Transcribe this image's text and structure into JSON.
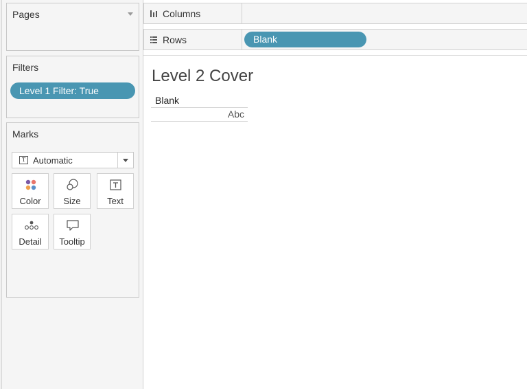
{
  "pages": {
    "title": "Pages"
  },
  "filters": {
    "title": "Filters",
    "items": [
      {
        "label": "Level 1 Filter: True"
      }
    ]
  },
  "marks": {
    "title": "Marks",
    "mark_type": "Automatic",
    "buttons": [
      {
        "label": "Color",
        "icon": "color-dots-icon"
      },
      {
        "label": "Size",
        "icon": "size-circles-icon"
      },
      {
        "label": "Text",
        "icon": "text-t-icon"
      },
      {
        "label": "Detail",
        "icon": "detail-dots-icon"
      },
      {
        "label": "Tooltip",
        "icon": "speech-bubble-icon"
      }
    ]
  },
  "shelves": {
    "columns": {
      "label": "Columns",
      "pills": []
    },
    "rows": {
      "label": "Rows",
      "pills": [
        {
          "label": "Blank"
        }
      ]
    }
  },
  "view": {
    "title": "Level 2 Cover",
    "column_header": "Blank",
    "cell_value": "Abc"
  },
  "colors": {
    "pill": "#4996b2",
    "pane_background": "#f5f5f5",
    "border": "#c8c8c8"
  }
}
